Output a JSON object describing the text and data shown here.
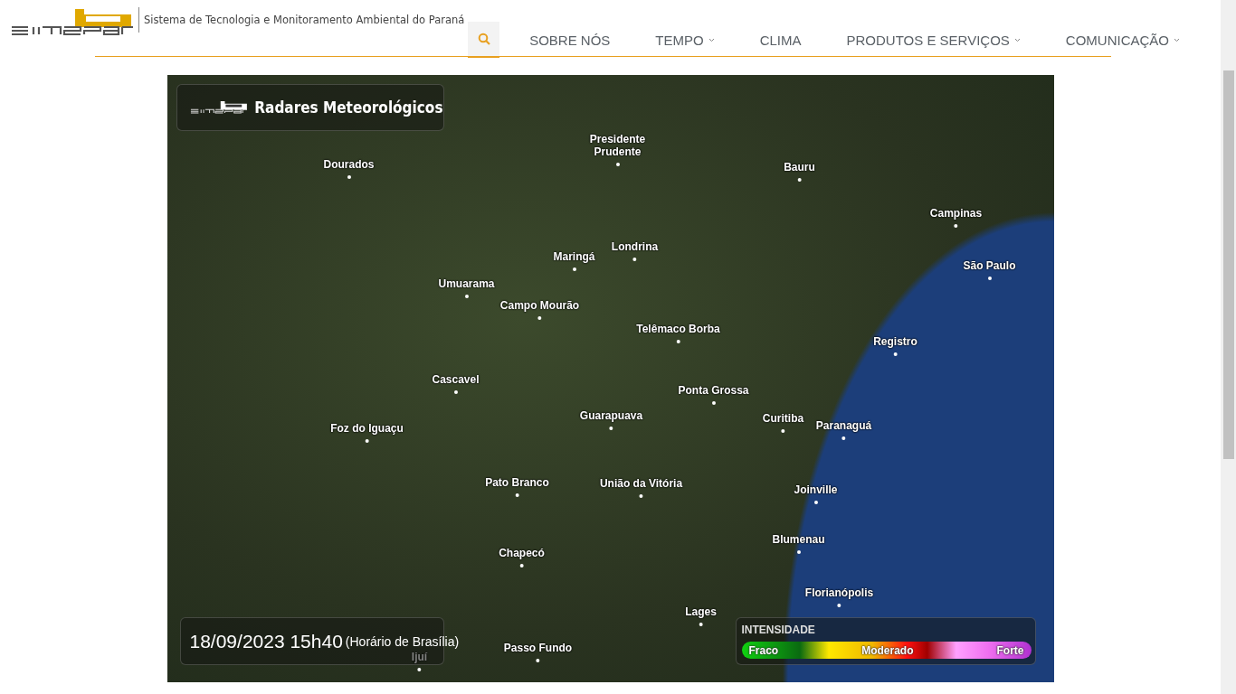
{
  "header": {
    "tagline": "Sistema de Tecnologia e Monitoramento Ambiental do Paraná",
    "nav": [
      {
        "label": "SOBRE NÓS",
        "dropdown": false
      },
      {
        "label": "TEMPO",
        "dropdown": true
      },
      {
        "label": "CLIMA",
        "dropdown": false
      },
      {
        "label": "PRODUTOS E SERVIÇOS",
        "dropdown": true
      },
      {
        "label": "COMUNICAÇÃO",
        "dropdown": true
      }
    ]
  },
  "map": {
    "title": "Radares Meteorológicos",
    "timestamp": "18/09/2023 15h40",
    "timezone": "(Horário de Brasília)",
    "cities": [
      "Dourados",
      "Presidente Prudente",
      "Bauru",
      "Campinas",
      "Maringá",
      "Londrina",
      "Umuarama",
      "Campo Mourão",
      "São Paulo",
      "Telêmaco Borba",
      "Registro",
      "Cascavel",
      "Ponta Grossa",
      "Foz do Iguaçu",
      "Guarapuava",
      "Curitiba",
      "Paranaguá",
      "Pato Branco",
      "União da Vitória",
      "Joinville",
      "Chapecó",
      "Blumenau",
      "Florianópolis",
      "Lages",
      "Passo Fundo",
      "Ijuí"
    ],
    "legend": {
      "title": "INTENSIDADE",
      "low": "Fraco",
      "mid": "Moderado",
      "high": "Forte"
    }
  }
}
